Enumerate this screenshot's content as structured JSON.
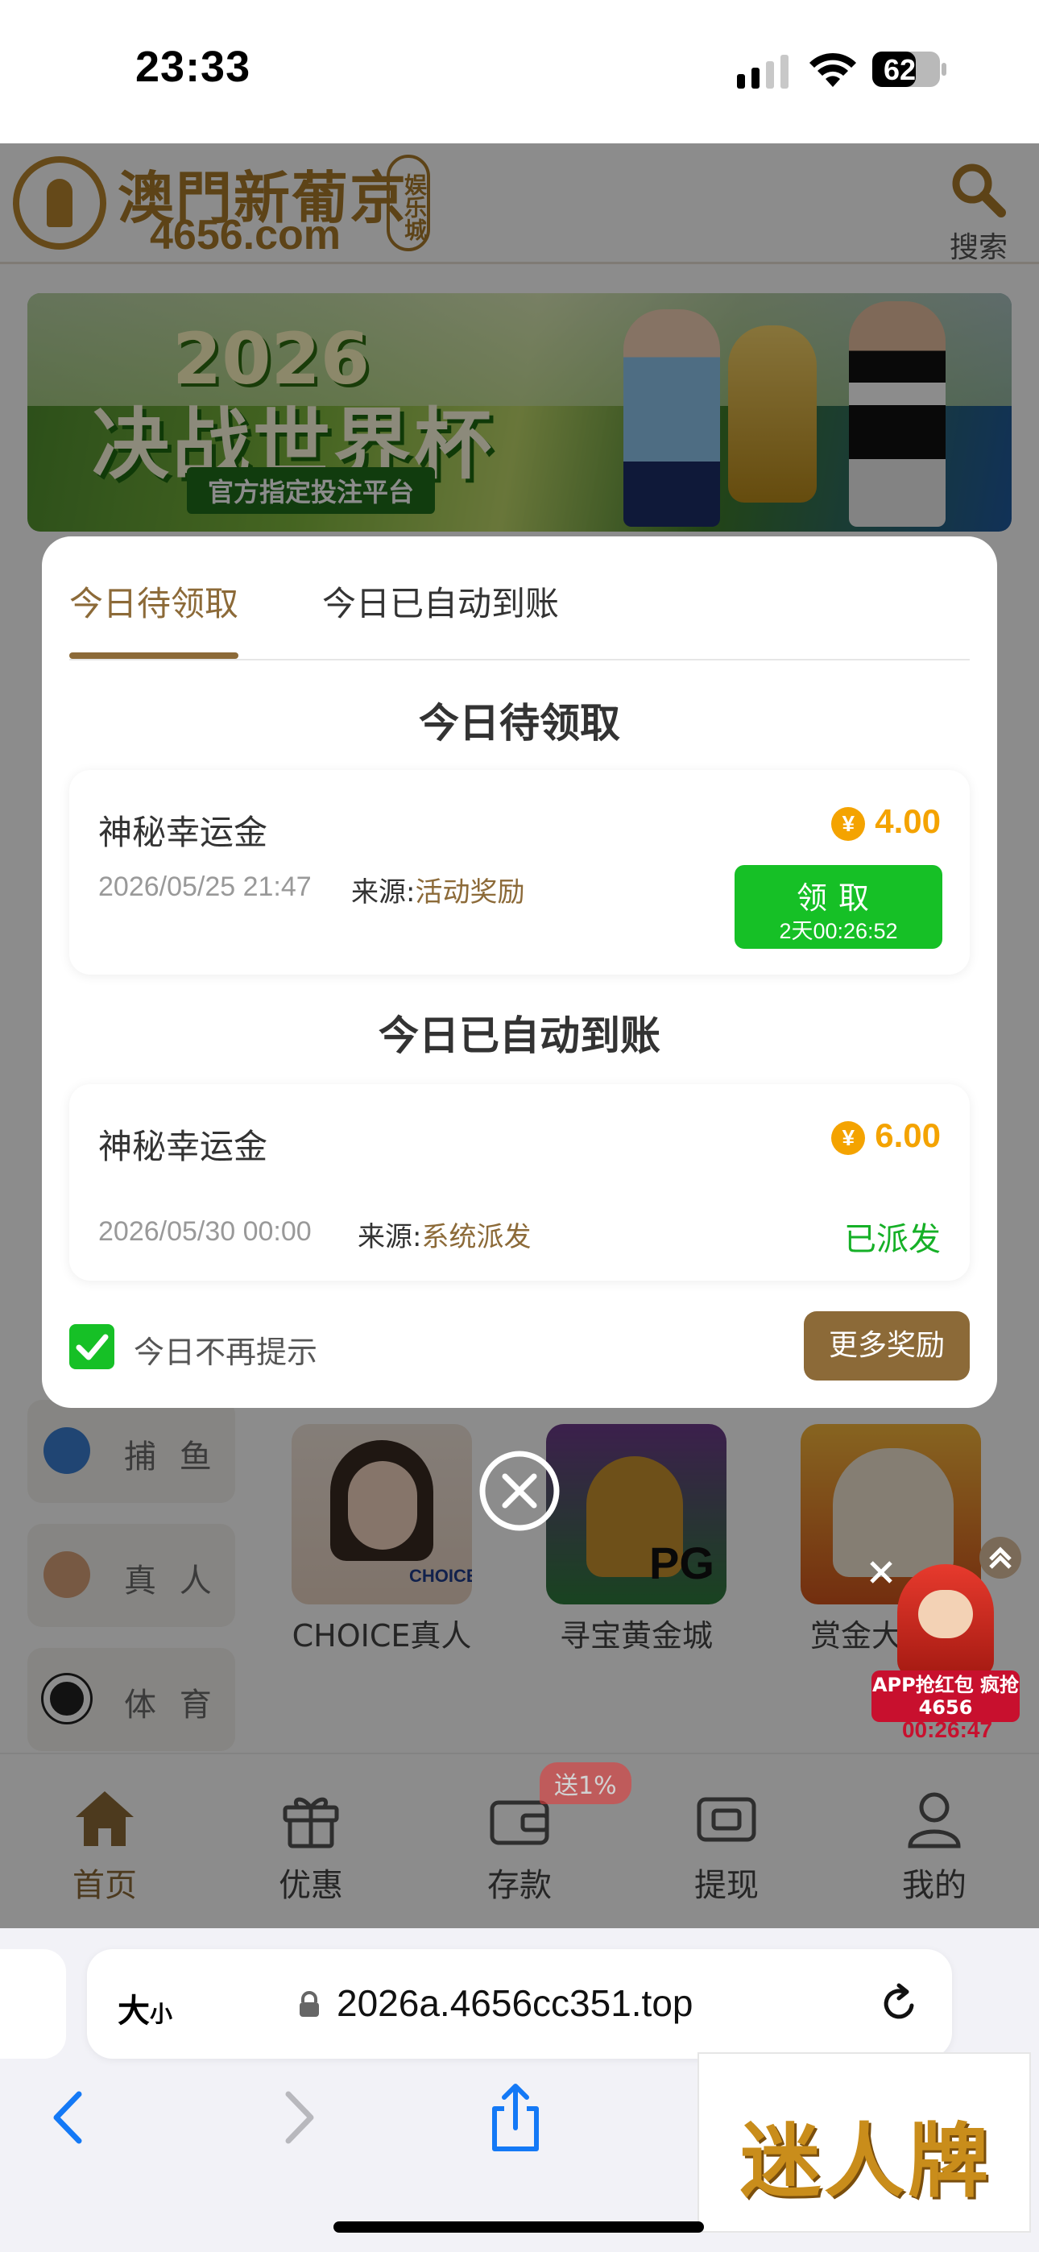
{
  "status_bar": {
    "time": "23:33",
    "battery": "62"
  },
  "site": {
    "logo_title": "澳門新葡京",
    "logo_domain": "4656.com",
    "logo_badge": "娱乐城",
    "search_label": "搜索"
  },
  "banner": {
    "year": "2026",
    "title": "决战世界杯",
    "subtitle": "官方指定投注平台"
  },
  "categories": [
    "捕 鱼",
    "真 人",
    "体 育"
  ],
  "games": [
    {
      "name": "CHOICE真人",
      "badge": "CHOICE"
    },
    {
      "name": "寻宝黄金城",
      "badge": "PG"
    },
    {
      "name": "赏金大"
    }
  ],
  "bottom_nav": {
    "items": [
      {
        "label": "首页",
        "icon": "home-icon"
      },
      {
        "label": "优惠",
        "icon": "gift-icon"
      },
      {
        "label": "存款",
        "icon": "wallet-icon"
      },
      {
        "label": "提现",
        "icon": "withdraw-icon"
      },
      {
        "label": "我的",
        "icon": "user-icon"
      }
    ],
    "deposit_badge": "送1%"
  },
  "modal": {
    "tabs": [
      "今日待领取",
      "今日已自动到账"
    ],
    "pending_section_title": "今日待领取",
    "pending": {
      "name": "神秘幸运金",
      "currency_symbol": "¥",
      "amount": "4.00",
      "date": "2026/05/25 21:47",
      "source_label": "来源:",
      "source": "活动奖励",
      "claim_label": "领取",
      "claim_timer": "2天00:26:52"
    },
    "credited_section_title": "今日已自动到账",
    "credited": {
      "name": "神秘幸运金",
      "currency_symbol": "¥",
      "amount": "6.00",
      "date": "2026/05/30 00:00",
      "source_label": "来源:",
      "source": "系统派发",
      "status": "已派发"
    },
    "dont_show_today": "今日不再提示",
    "dont_show_checked": true,
    "more_rewards": "更多奖励"
  },
  "promo_float": {
    "text": "APP抢红包 疯抢4656",
    "timer": "00:26:47"
  },
  "safari": {
    "aa_label": "大",
    "aa_small": "小",
    "url": "2026a.4656cc351.top"
  },
  "watermark": "迷人牌",
  "colors": {
    "accent_gold": "#8c6a38",
    "claim_green": "#16c026",
    "amount_orange": "#f4a300"
  }
}
